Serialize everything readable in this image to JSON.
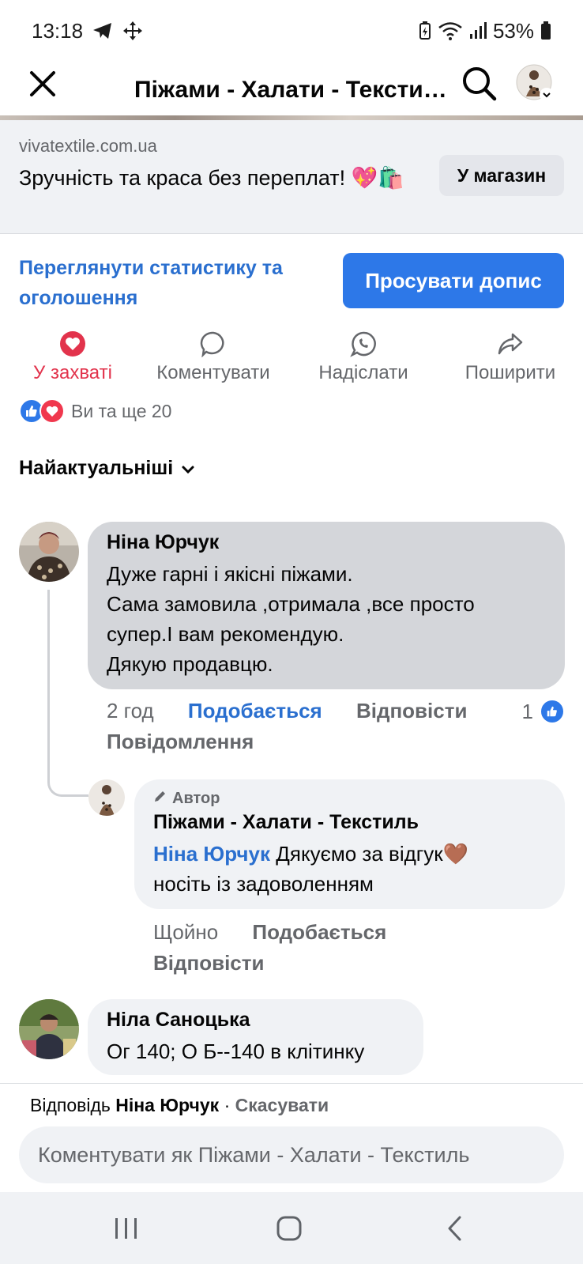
{
  "status": {
    "time": "13:18",
    "battery": "53%"
  },
  "appbar": {
    "title": "Піжами - Халати - Текстиль"
  },
  "ad": {
    "domain": "vivatextile.com.ua",
    "headline": "Зручність та краса без переплат! 💖🛍️",
    "shop_button": "У магазин"
  },
  "promote": {
    "stats_link": "Переглянути статистику та оголошення",
    "boost_button": "Просувати допис"
  },
  "actions": [
    {
      "label": "У захваті",
      "icon": "heart-icon"
    },
    {
      "label": "Коментувати",
      "icon": "comment-icon"
    },
    {
      "label": "Надіслати",
      "icon": "whatsapp-icon"
    },
    {
      "label": "Поширити",
      "icon": "share-icon"
    }
  ],
  "reactions": {
    "text": "Ви та ще 20"
  },
  "sort": {
    "label": "Найактуальніші"
  },
  "comments": [
    {
      "author": "Ніна Юрчук",
      "text": "Дуже гарні і якісні піжами.\nСама замовила ,отримала ,все просто супер.І вам рекомендую.\nДякую продавцю.",
      "time": "2 год",
      "like": "Подобається",
      "reply": "Відповісти",
      "like_count": "1",
      "message": "Повідомлення"
    },
    {
      "author_tag": "Автор",
      "author": "Піжами - Халати - Текстиль",
      "mention": "Ніна Юрчук",
      "text": "Дякуємо за відгук🤎\nносіть із задоволенням",
      "time": "Щойно",
      "like": "Подобається",
      "reply": "Відповісти"
    },
    {
      "author": "Ніла Саноцька",
      "text": "Ог 140; О Б--140 в клітинку"
    }
  ],
  "reply_bar": {
    "prefix": "Відповідь",
    "target": "Ніна Юрчук",
    "sep": " · ",
    "cancel": "Скасувати",
    "placeholder": "Коментувати як Піжами - Халати - Текстиль"
  },
  "colors": {
    "accent": "#2d78e8",
    "love": "#e2334c"
  }
}
